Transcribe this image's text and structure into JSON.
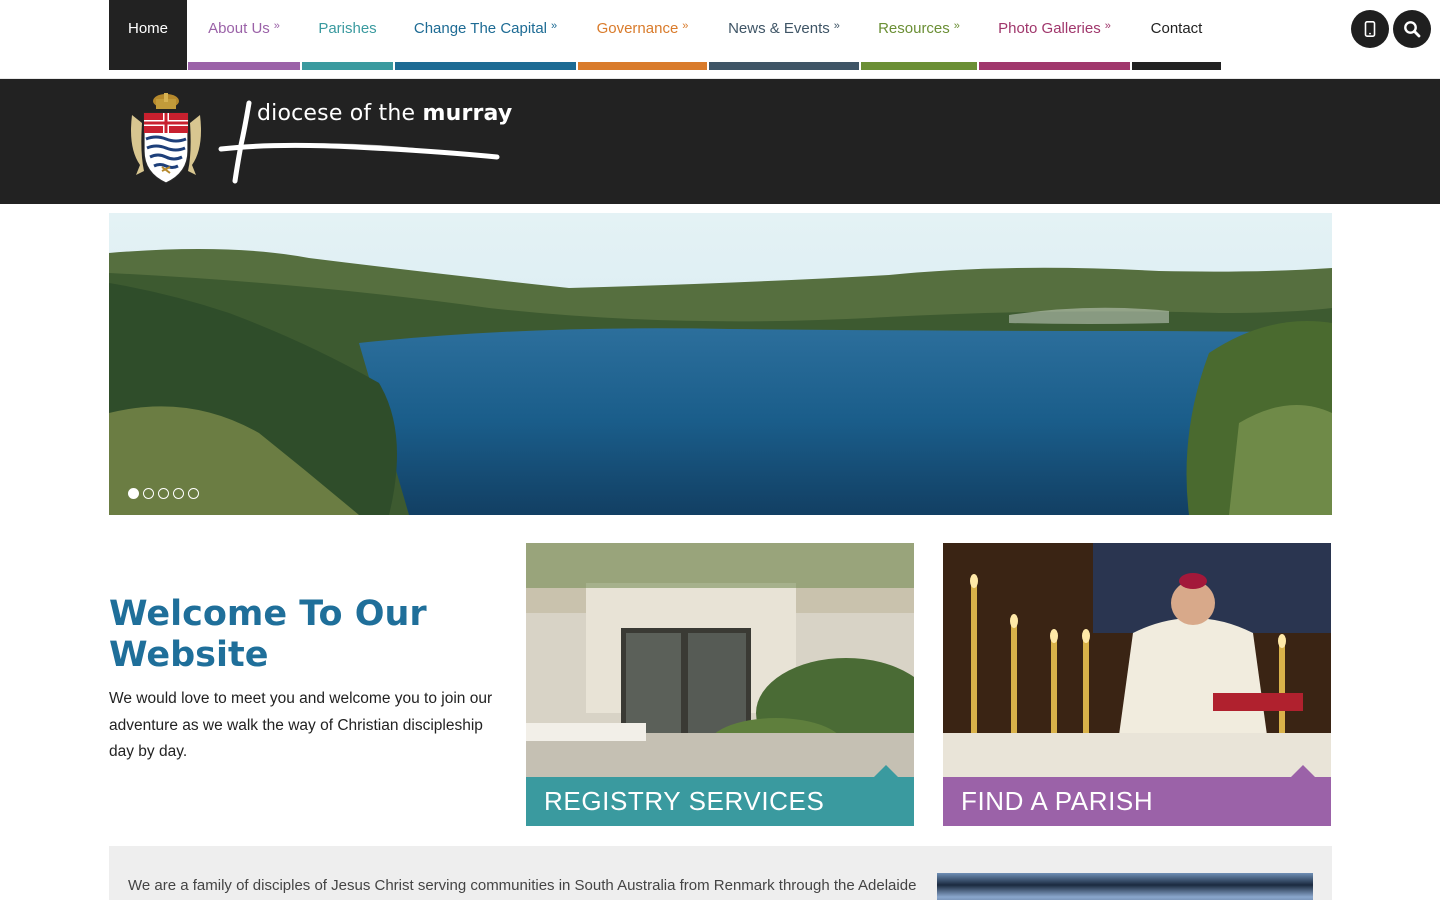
{
  "nav": {
    "items": [
      {
        "label": "Home",
        "color": "#222222",
        "dropdown": false
      },
      {
        "label": "About Us",
        "color": "#9b62a8",
        "dropdown": true
      },
      {
        "label": "Parishes",
        "color": "#3a9a9f",
        "dropdown": false
      },
      {
        "label": "Change The Capital",
        "color": "#1d6b94",
        "dropdown": true
      },
      {
        "label": "Governance",
        "color": "#d97b2b",
        "dropdown": true
      },
      {
        "label": "News & Events",
        "color": "#3f5566",
        "dropdown": true
      },
      {
        "label": "Resources",
        "color": "#6b8f35",
        "dropdown": true
      },
      {
        "label": "Photo Galleries",
        "color": "#a0376c",
        "dropdown": true
      },
      {
        "label": "Contact",
        "color": "#222222",
        "dropdown": false
      }
    ],
    "chevron": "»",
    "phone_icon": "mobile-phone-icon",
    "search_icon": "search-icon"
  },
  "header": {
    "logo_text_regular": "diocese of the ",
    "logo_text_bold": "murray"
  },
  "hero": {
    "slide_count": 5,
    "active_slide": 1
  },
  "welcome": {
    "title": "Welcome To Our Website",
    "body": "We would love to meet you and welcome you to join our adventure as we walk the way of Christian discipleship day by day."
  },
  "tiles": [
    {
      "label": "REGISTRY SERVICES",
      "color": "#3a9a9f"
    },
    {
      "label": "FIND A PARISH",
      "color": "#9b62a8"
    }
  ],
  "about": {
    "text": "We are a family of disciples of Jesus Christ serving communities in South Australia from Renmark through the Adelaide"
  }
}
